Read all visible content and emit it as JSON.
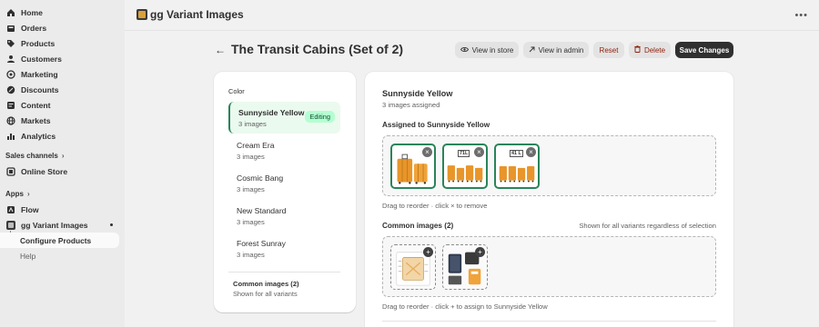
{
  "sidebar": {
    "items": [
      {
        "label": "Home",
        "icon": "home-icon"
      },
      {
        "label": "Orders",
        "icon": "orders-icon"
      },
      {
        "label": "Products",
        "icon": "tag-icon"
      },
      {
        "label": "Customers",
        "icon": "person-icon"
      },
      {
        "label": "Marketing",
        "icon": "target-icon"
      },
      {
        "label": "Discounts",
        "icon": "discount-icon"
      },
      {
        "label": "Content",
        "icon": "content-icon"
      },
      {
        "label": "Markets",
        "icon": "globe-icon"
      },
      {
        "label": "Analytics",
        "icon": "chart-icon"
      }
    ],
    "sales_channels_label": "Sales channels",
    "online_store_label": "Online Store",
    "apps_label": "Apps",
    "flow_label": "Flow",
    "app_label": "gg Variant Images",
    "configure_label": "Configure Products",
    "help_label": "Help"
  },
  "topbar": {
    "app_title": "gg Variant Images",
    "more_label": "•••"
  },
  "page": {
    "title": "The Transit Cabins (Set of 2)",
    "back_label": "←",
    "view_store_label": "View in store",
    "view_admin_label": "View in admin",
    "reset_label": "Reset",
    "delete_label": "Delete",
    "save_label": "Save Changes"
  },
  "variants": {
    "heading": "Color",
    "editing_badge": "Editing",
    "list": [
      {
        "name": "Sunnyside Yellow",
        "count": "3 images"
      },
      {
        "name": "Cream Era",
        "count": "3 images"
      },
      {
        "name": "Cosmic Bang",
        "count": "3 images"
      },
      {
        "name": "New Standard",
        "count": "3 images"
      },
      {
        "name": "Forest Sunray",
        "count": "3 images"
      }
    ],
    "common_title": "Common images (2)",
    "common_sub": "Shown for all variants"
  },
  "detail": {
    "title": "Sunnyside Yellow",
    "subtitle": "3 images assigned",
    "assigned_heading": "Assigned to Sunnyside Yellow",
    "assigned_hint": "Drag to reorder · click × to remove",
    "assigned_tags": [
      "",
      "71L",
      "41 L"
    ],
    "common_heading": "Common images (2)",
    "common_right": "Shown for all variants regardless of selection",
    "common_hint": "Drag to reorder · click + to assign to Sunnyside Yellow",
    "remove_symbol": "×",
    "add_symbol": "+"
  },
  "colors": {
    "accent_green": "#29845a",
    "badge_bg": "#b4fed2",
    "save_bg": "#303030",
    "danger_text": "#8e1f0b",
    "suitcase_orange": "#e8952a"
  }
}
